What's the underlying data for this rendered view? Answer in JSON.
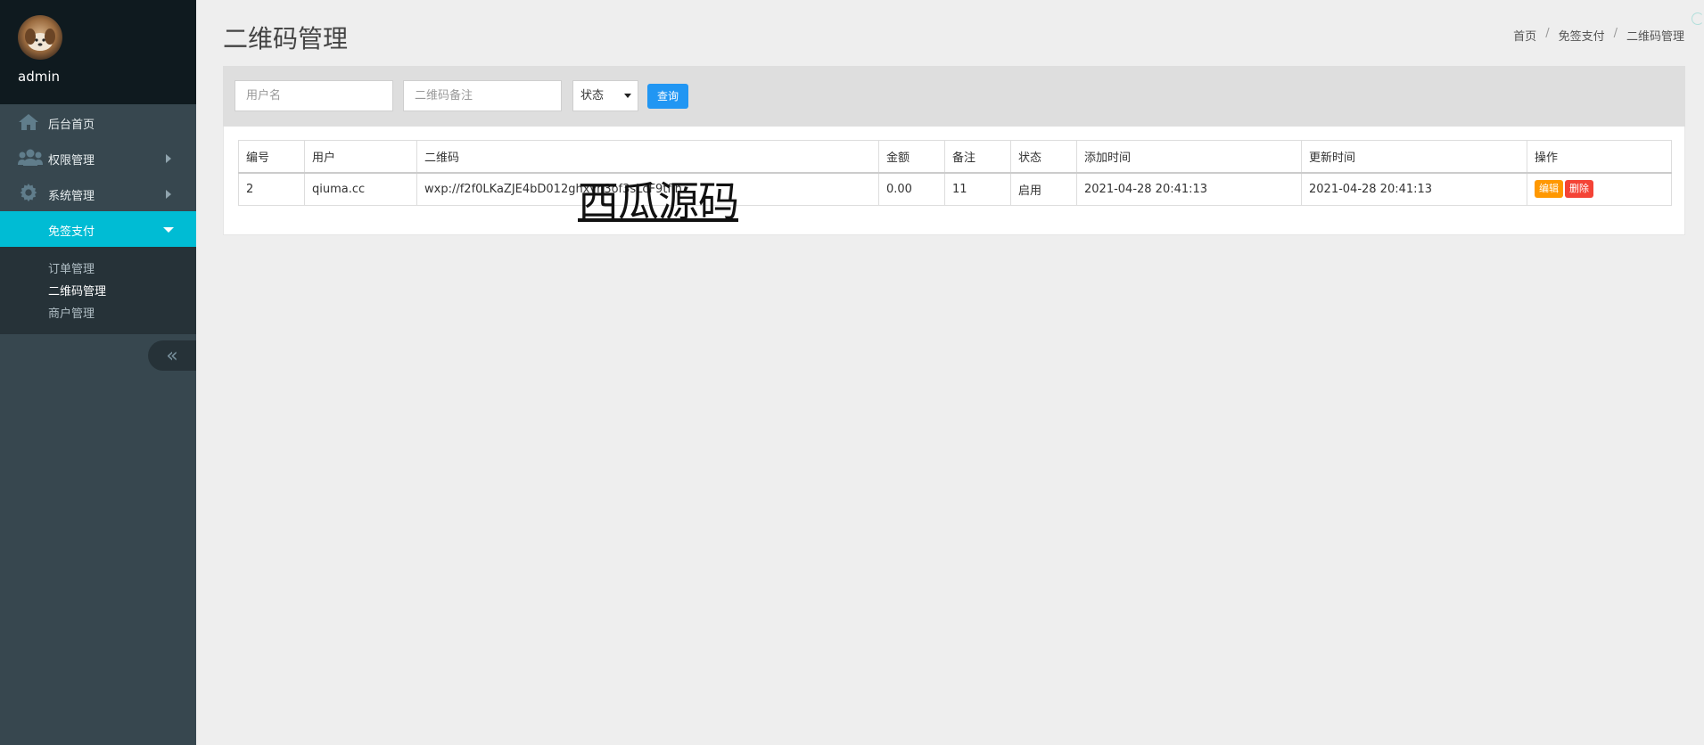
{
  "user": {
    "name": "admin"
  },
  "nav": {
    "items": [
      {
        "label": "后台首页",
        "icon": "home-icon"
      },
      {
        "label": "权限管理",
        "icon": "users-icon"
      },
      {
        "label": "系统管理",
        "icon": "gear-icon"
      },
      {
        "label": "免签支付",
        "icon": ""
      }
    ],
    "submenu": [
      {
        "label": "订单管理"
      },
      {
        "label": "二维码管理"
      },
      {
        "label": "商户管理"
      }
    ],
    "collapse_glyph": "«"
  },
  "page": {
    "title": "二维码管理"
  },
  "breadcrumb": [
    "首页",
    "免签支付",
    "二维码管理"
  ],
  "breadcrumb_separator": "/",
  "search": {
    "username_placeholder": "用户名",
    "remark_placeholder": "二维码备注",
    "status_selected": "状态",
    "query_label": "查询"
  },
  "table": {
    "columns": [
      "编号",
      "用户",
      "二维码",
      "金额",
      "备注",
      "状态",
      "添加时间",
      "更新时间",
      "操作"
    ],
    "rows": [
      {
        "id": "2",
        "user": "qiuma.cc",
        "qrcode": "wxp://f2f0LKaZJE4bD012ghxvn3of3sLcF9tfln",
        "amount": "0.00",
        "remark": "11",
        "status": "启用",
        "created": "2021-04-28 20:41:13",
        "updated": "2021-04-28 20:41:13",
        "edit_label": "编辑",
        "delete_label": "删除"
      }
    ]
  },
  "watermark": "西瓜源码",
  "colors": {
    "sidebar_bg": "#37474f",
    "sidebar_header_bg": "#0f1a1f",
    "active_nav": "#00bcd4",
    "primary": "#2196f3",
    "warning": "#ff9800",
    "danger": "#f44336"
  }
}
